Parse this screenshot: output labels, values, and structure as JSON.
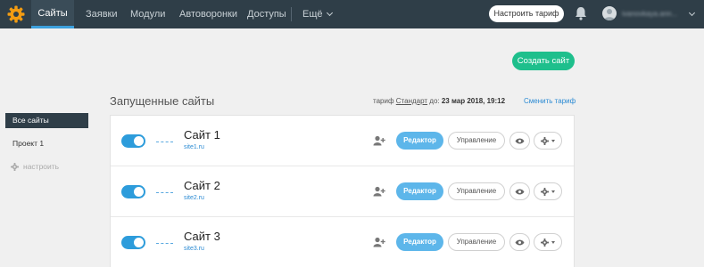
{
  "nav": {
    "items": [
      {
        "label": "Сайты",
        "active": true
      },
      {
        "label": "Заявки"
      },
      {
        "label": "Модули"
      },
      {
        "label": "Автоворонки"
      },
      {
        "label": "Доступы"
      },
      {
        "label": "Ещё"
      }
    ],
    "tariff_button": "Настроить тариф",
    "user_name": "ivanovkaya.ann...",
    "icons": {
      "logo": "gear-logo-icon",
      "bell": "bell-icon",
      "avatar": "user-avatar-icon"
    }
  },
  "create_button": "Создать сайт",
  "sidebar": {
    "all_sites": "Все сайты",
    "project": "Проект 1",
    "settings": "настроить"
  },
  "main": {
    "title": "Запущенные сайты",
    "tariff_prefix": "тариф",
    "tariff_name": "Стандарт",
    "tariff_until": "до:",
    "tariff_date": "23 мар 2018, 19:12",
    "change_tariff": "Сменить тариф"
  },
  "sites": [
    {
      "name": "Сайт 1",
      "domain": "site1.ru",
      "enabled": true,
      "editor": "Редактор",
      "manage": "Управление"
    },
    {
      "name": "Сайт 2",
      "domain": "site2.ru",
      "enabled": true,
      "editor": "Редактор",
      "manage": "Управление"
    },
    {
      "name": "Сайт 3",
      "domain": "site3.ru",
      "enabled": true,
      "editor": "Редактор",
      "manage": "Управление"
    }
  ],
  "colors": {
    "topbar": "#2f3e48",
    "accent_green": "#1ebf8c",
    "accent_blue": "#2d9cdb",
    "logo_orange": "#f39c12"
  }
}
